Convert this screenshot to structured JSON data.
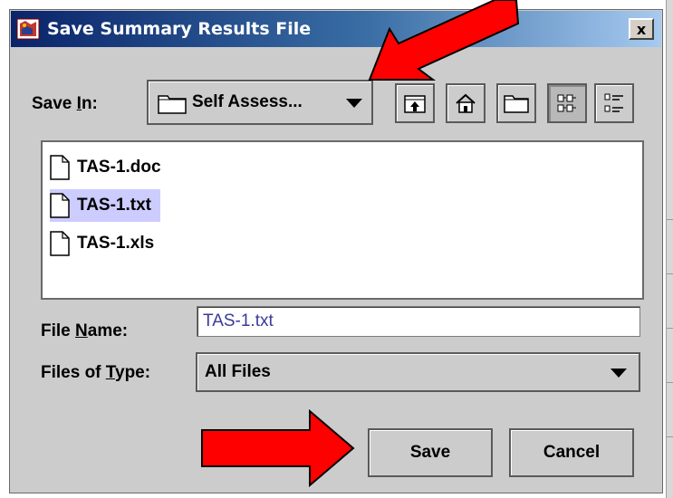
{
  "window": {
    "title": "Save Summary Results File",
    "close_label": "x"
  },
  "toolbar": {
    "save_in_label_pre": "Save ",
    "save_in_label_key": "I",
    "save_in_label_post": "n:",
    "location_value": "Self Assess...",
    "icons": [
      "up-one-level-icon",
      "home-icon",
      "new-folder-icon",
      "list-view-icon",
      "details-view-icon"
    ]
  },
  "files": [
    {
      "name": "TAS-1.doc",
      "selected": false
    },
    {
      "name": "TAS-1.txt",
      "selected": true
    },
    {
      "name": "TAS-1.xls",
      "selected": false
    }
  ],
  "form": {
    "file_name_label_pre": "File ",
    "file_name_label_key": "N",
    "file_name_label_post": "ame:",
    "file_name_value": "TAS-1.txt",
    "file_type_label_pre": "Files of ",
    "file_type_label_key": "T",
    "file_type_label_post": "ype:",
    "file_type_value": "All Files"
  },
  "buttons": {
    "save": "Save",
    "cancel": "Cancel"
  },
  "colors": {
    "annotation_arrow": "#ff0000",
    "selection": "#ccccff",
    "dialog_bg": "#cccccc"
  }
}
